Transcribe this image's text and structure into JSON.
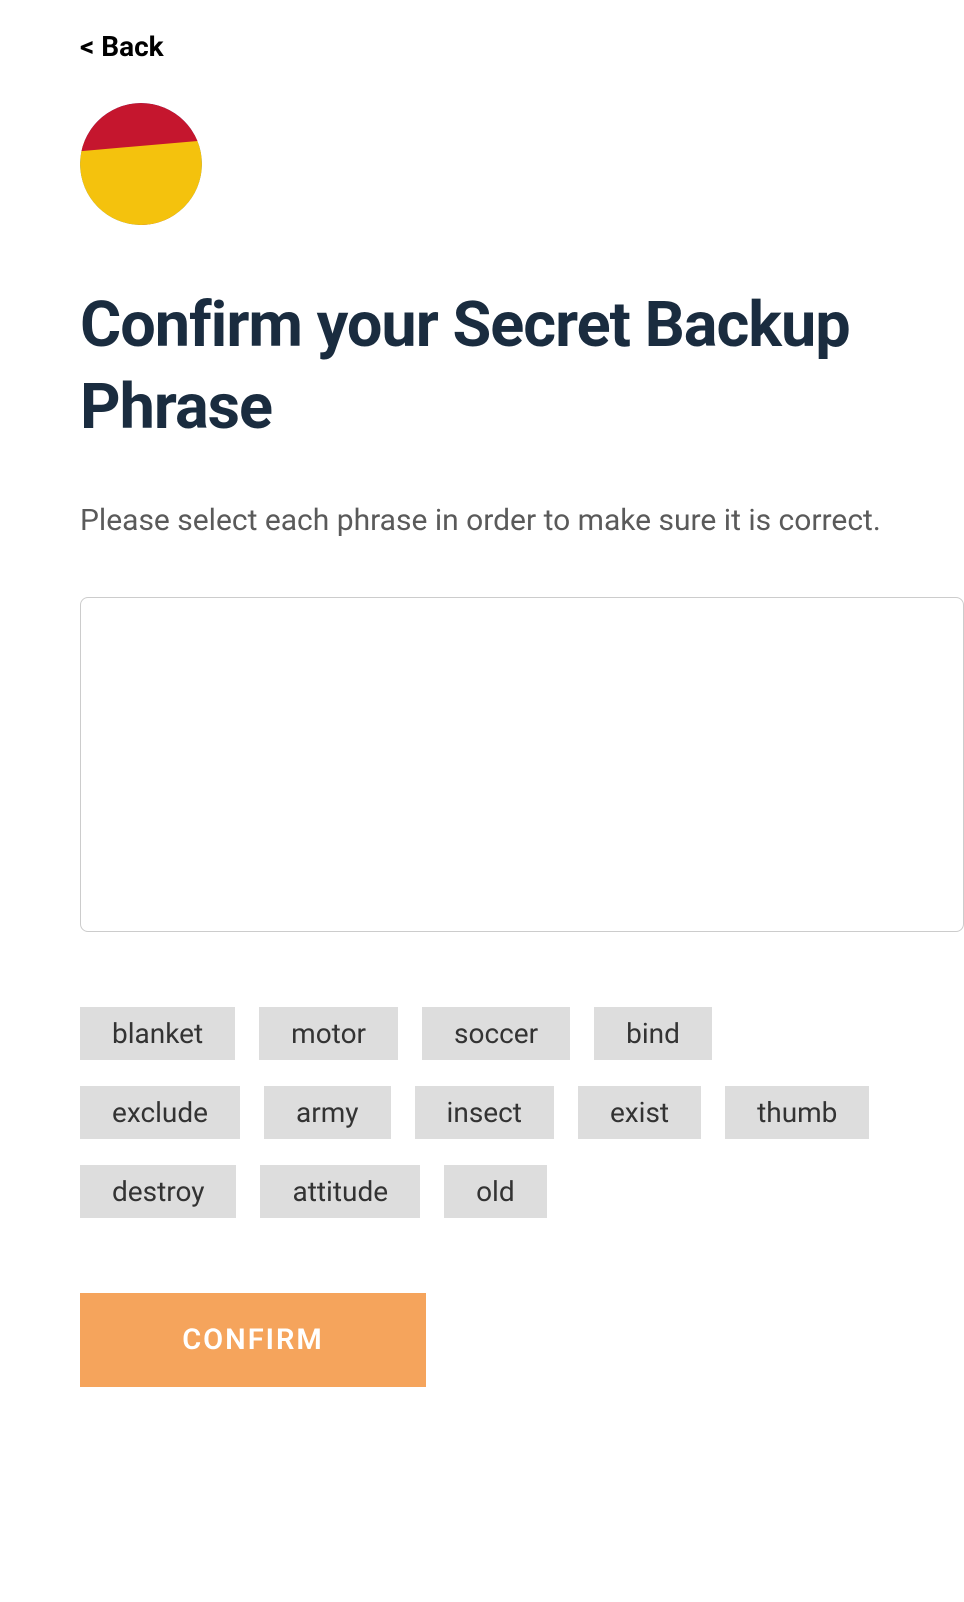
{
  "nav": {
    "back_label": "< Back"
  },
  "header": {
    "title": "Confirm your Secret Backup Phrase"
  },
  "body": {
    "description": "Please select each phrase in order to make sure it is correct."
  },
  "words": [
    "blanket",
    "motor",
    "soccer",
    "bind",
    "exclude",
    "army",
    "insect",
    "exist",
    "thumb",
    "destroy",
    "attitude",
    "old"
  ],
  "actions": {
    "confirm_label": "CONFIRM"
  }
}
